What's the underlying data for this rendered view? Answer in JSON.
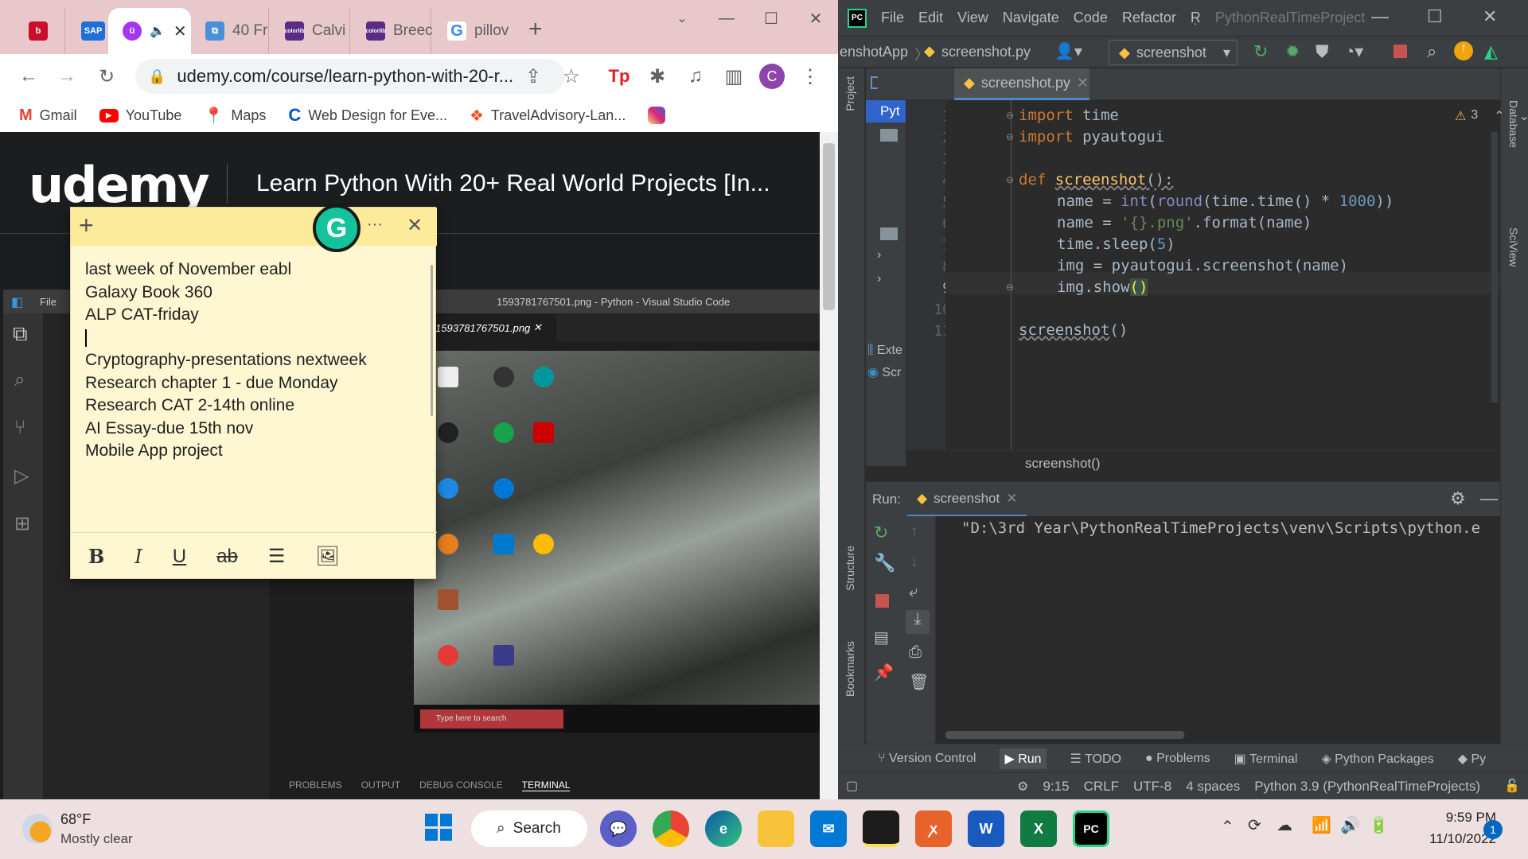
{
  "chrome": {
    "tabs": [
      {
        "label": "",
        "favicon": "b-icon",
        "color": "#c8102e"
      },
      {
        "label": "",
        "favicon": "sap-icon",
        "color": "#1e6fd9"
      },
      {
        "label": "",
        "favicon": "udemy-icon",
        "color": "#a435f0",
        "active": true
      },
      {
        "label": "40 Fr",
        "favicon": "page-icon",
        "color": "#4a90d9"
      },
      {
        "label": "Calvi",
        "favicon": "colorlib-icon",
        "color": "#5b2c83"
      },
      {
        "label": "Breec",
        "favicon": "colorlib-icon",
        "color": "#5b2c83"
      },
      {
        "label": "pillov",
        "favicon": "google-icon",
        "color": "#4285f4"
      }
    ],
    "url": "udemy.com/course/learn-python-with-20-r...",
    "profile_initial": "C",
    "bookmarks": [
      {
        "label": "Gmail",
        "icon": "gmail-icon"
      },
      {
        "label": "YouTube",
        "icon": "youtube-icon"
      },
      {
        "label": "Maps",
        "icon": "maps-icon"
      },
      {
        "label": "Web Design for Eve...",
        "icon": "coursera-icon"
      },
      {
        "label": "TravelAdvisory-Lan...",
        "icon": "figma-icon"
      },
      {
        "label": "",
        "icon": "instagram-icon"
      }
    ],
    "udemy": {
      "logo": "udemy",
      "course_title": "Learn Python With 20+ Real World Projects [In..."
    },
    "video": {
      "vscode_title": "1593781767501.png - Python - Visual Studio Code",
      "vscode_file_menu": "File",
      "vscode_tab": "1593781767501.png",
      "terminal_tabs": [
        "PROBLEMS",
        "OUTPUT",
        "DEBUG CONSOLE",
        "TERMINAL"
      ],
      "win_search": "Type here to search"
    }
  },
  "sticky": {
    "lines": [
      "last week of November eabl",
      "Galaxy Book 360",
      "ALP CAT-friday",
      "",
      "Cryptography-presentations nextweek",
      "Research chapter 1 - due Monday",
      "Research CAT 2-14th  online",
      "AI Essay-due 15th nov",
      "Mobile App project"
    ],
    "more_label": "···",
    "grammarly": "G"
  },
  "pycharm": {
    "menu": [
      "File",
      "Edit",
      "View",
      "Navigate",
      "Code",
      "Refactor",
      "Ṛ",
      "PythonRealTimeProject"
    ],
    "breadcrumb_project": "enshotApp",
    "breadcrumb_file": "screenshot.py",
    "run_config": "screenshot",
    "editor_tab": "screenshot.py",
    "warnings": "3",
    "project_label": "Project",
    "project_items": [
      "Pyt",
      "Exte",
      "Scr"
    ],
    "lines": [
      "1",
      "2",
      "3",
      "4",
      "5",
      "6",
      "7",
      "8",
      "9",
      "10",
      "11"
    ],
    "code": {
      "l1": [
        "import",
        "time"
      ],
      "l2": [
        "import",
        "pyautogui"
      ],
      "l4": [
        "def",
        "screenshot",
        "():"
      ],
      "l5": [
        "name = ",
        "int",
        "(",
        "round",
        "(time.time() * ",
        "1000",
        "))"
      ],
      "l6": [
        "name = ",
        "'{}.png'",
        ".format(name)"
      ],
      "l7": [
        "time.sleep(",
        "5",
        ")"
      ],
      "l8": [
        "img = pyautogui.screenshot(name)"
      ],
      "l9": [
        "img.show",
        "()"
      ],
      "l11": [
        "screenshot",
        "()"
      ]
    },
    "editor_breadcrumb": "screenshot()",
    "run_label": "Run:",
    "run_tab": "screenshot",
    "run_output": "\"D:\\3rd Year\\PythonRealTimeProjects\\venv\\Scripts\\python.e",
    "right_strip": [
      "Database",
      "SciView"
    ],
    "left_strip": [
      "Structure",
      "Bookmarks"
    ],
    "tool_windows": [
      "Version Control",
      "Run",
      "TODO",
      "Problems",
      "Terminal",
      "Python Packages",
      "Py"
    ],
    "status": {
      "position": "9:15",
      "line_sep": "CRLF",
      "encoding": "UTF-8",
      "indent": "4 spaces",
      "interpreter": "Python 3.9 (PythonRealTimeProjects)"
    }
  },
  "taskbar": {
    "weather_temp": "68°F",
    "weather_desc": "Mostly clear",
    "search_label": "Search",
    "time": "9:59 PM",
    "date": "11/10/2022",
    "notif_count": "1"
  },
  "colors": {
    "udemy_purple": "#a435f0",
    "pycharm_bg": "#2b2b2b",
    "keyword": "#cc7832",
    "number": "#6897bb",
    "string": "#6a8759",
    "sticky_bg": "#fff7d1"
  }
}
